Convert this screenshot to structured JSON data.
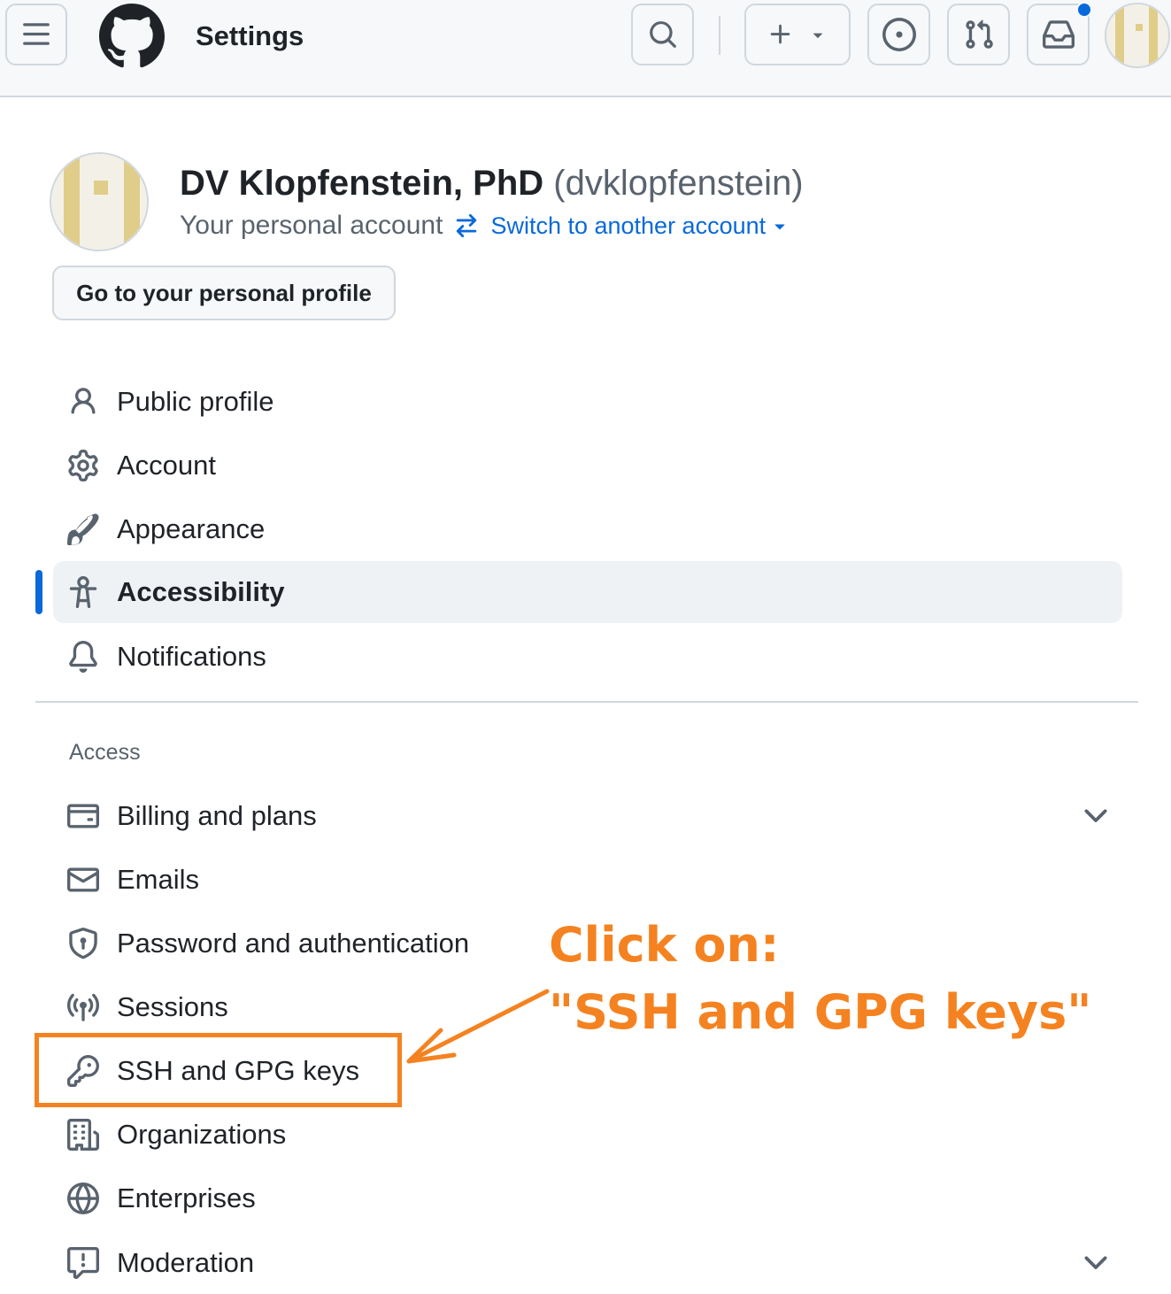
{
  "header": {
    "title": "Settings",
    "menu_icon": "hamburger-icon",
    "logo_icon": "github-mark-icon",
    "search_icon": "search-icon",
    "create_icon": "plus-icon",
    "issues_icon": "issue-opened-icon",
    "pulls_icon": "git-pull-request-icon",
    "inbox_icon": "inbox-icon"
  },
  "account": {
    "name": "DV Klopfenstein, PhD",
    "username": "(dvklopfenstein)",
    "subtitle": "Your personal account",
    "switch_label": "Switch to another account",
    "profile_button": "Go to your personal profile"
  },
  "nav": {
    "items": [
      {
        "label": "Public profile",
        "icon": "person-icon"
      },
      {
        "label": "Account",
        "icon": "gear-icon"
      },
      {
        "label": "Appearance",
        "icon": "paintbrush-icon"
      },
      {
        "label": "Accessibility",
        "icon": "accessibility-icon",
        "active": true
      },
      {
        "label": "Notifications",
        "icon": "bell-icon"
      }
    ],
    "access_heading": "Access",
    "access_items": [
      {
        "label": "Billing and plans",
        "icon": "credit-card-icon",
        "expandable": true
      },
      {
        "label": "Emails",
        "icon": "mail-icon"
      },
      {
        "label": "Password and authentication",
        "icon": "shield-lock-icon"
      },
      {
        "label": "Sessions",
        "icon": "broadcast-icon"
      },
      {
        "label": "SSH and GPG keys",
        "icon": "key-icon",
        "highlighted": true
      },
      {
        "label": "Organizations",
        "icon": "organization-icon"
      },
      {
        "label": "Enterprises",
        "icon": "globe-icon"
      },
      {
        "label": "Moderation",
        "icon": "report-icon",
        "expandable": true
      }
    ]
  },
  "annotation": {
    "line1": "Click on:",
    "line2": "\"SSH and GPG keys\"",
    "color": "#f58220"
  },
  "colors": {
    "accent": "#0969da",
    "active_bg": "#eff2f5",
    "header_bg": "#f6f8fa",
    "avatar_stripe": "#e0cd8a"
  }
}
